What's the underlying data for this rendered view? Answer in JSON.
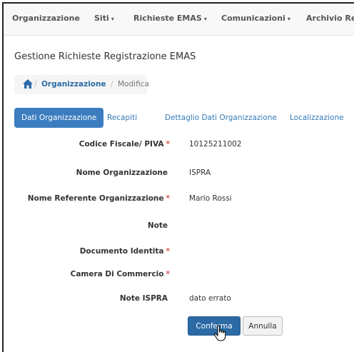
{
  "navbar": {
    "items": [
      {
        "label": "Organizzazione",
        "caret": ""
      },
      {
        "label": "Siti",
        "caret": "▾"
      },
      {
        "label": "Richieste EMAS",
        "caret": "▾"
      },
      {
        "label": "Comunicazioni",
        "caret": "▾"
      },
      {
        "label": "Archivio Reg",
        "caret": ""
      }
    ]
  },
  "page": {
    "title": "Gestione Richieste Registrazione EMAS"
  },
  "breadcrumb": {
    "separator": "/",
    "link": "Organizzazione",
    "current": "Modifica",
    "icon": "home-icon"
  },
  "tabs": [
    {
      "label": "Dati Organizzazione",
      "active": true
    },
    {
      "label": "Recapiti"
    },
    {
      "label": "Dettaglio Dati Organizzazione"
    },
    {
      "label": "Localizzazione"
    }
  ],
  "form": {
    "fields": [
      {
        "label": "Codice Fiscale/ PIVA",
        "required": "*",
        "value": "10125211002"
      },
      {
        "label": "Nome Organizzazione",
        "required": "",
        "value": "ISPRA"
      },
      {
        "label": "Nome Referente Organizzazione",
        "required": "*",
        "value": "Mario Rossi"
      },
      {
        "label": "Note",
        "required": "",
        "value": ""
      },
      {
        "label": "Documento Identita",
        "required": "*",
        "value": ""
      },
      {
        "label": "Camera Di Commercio",
        "required": "*",
        "value": ""
      },
      {
        "label": "Note ISPRA",
        "required": "",
        "value": "dato errato"
      }
    ]
  },
  "buttons": {
    "confirm": "Conferma",
    "cancel": "Annulla"
  },
  "colors": {
    "primary": "#2c6aa6",
    "link": "#337ab7",
    "required": "#d9534f"
  }
}
